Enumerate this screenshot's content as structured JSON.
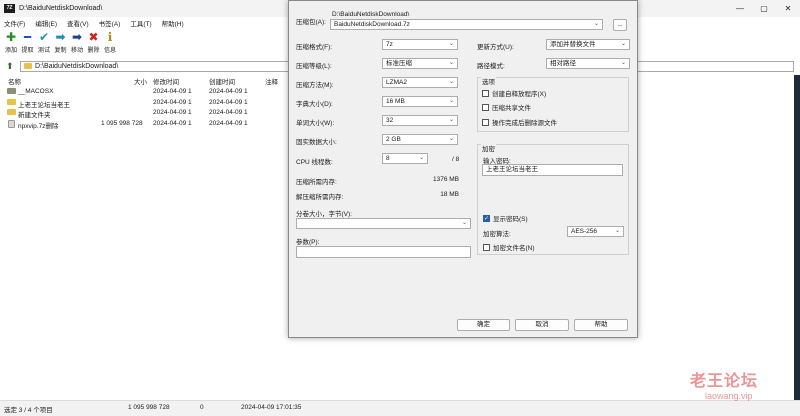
{
  "window": {
    "app_icon": "7Z",
    "title": "D:\\BaiduNetdiskDownload\\",
    "controls": {
      "minimize": "—",
      "maximize": "▢",
      "close": "✕"
    }
  },
  "menu": [
    "文件(F)",
    "编辑(E)",
    "查看(V)",
    "书签(A)",
    "工具(T)",
    "帮助(H)"
  ],
  "toolbar": [
    {
      "label": "添加",
      "icon": "plus-icon",
      "glyph": "✚",
      "color": "#1f8f1f"
    },
    {
      "label": "提取",
      "icon": "minus-icon",
      "glyph": "━",
      "color": "#1f4fb0"
    },
    {
      "label": "测试",
      "icon": "check-icon",
      "glyph": "✔",
      "color": "#1a9bb0"
    },
    {
      "label": "复制",
      "icon": "copy-arrow-icon",
      "glyph": "➡",
      "color": "#1a8fb0"
    },
    {
      "label": "移动",
      "icon": "move-arrow-icon",
      "glyph": "➡",
      "color": "#1f3f90"
    },
    {
      "label": "删除",
      "icon": "delete-icon",
      "glyph": "✖",
      "color": "#d02020"
    },
    {
      "label": "信息",
      "icon": "info-icon",
      "glyph": "ℹ",
      "color": "#b08a1a"
    }
  ],
  "address": {
    "path": "D:\\BaiduNetdiskDownload\\"
  },
  "file_list": {
    "columns": [
      "名称",
      "大小",
      "修改时间",
      "创建时间",
      "注释"
    ],
    "rows": [
      {
        "name": "__MACOSX",
        "size": "",
        "modified": "2024-04-09 1",
        "created": "2024-04-09 1",
        "type": "folder-dark"
      },
      {
        "name": "上老王论坛当老王",
        "size": "",
        "modified": "2024-04-09 1",
        "created": "2024-04-09 1",
        "type": "folder"
      },
      {
        "name": "新建文件夹",
        "size": "",
        "modified": "2024-04-09 1",
        "created": "2024-04-09 1",
        "type": "folder"
      },
      {
        "name": "npxvip.7z删除",
        "size": "1 095 998 728",
        "modified": "2024-04-09 1",
        "created": "2024-04-09 1",
        "type": "file"
      }
    ]
  },
  "status": {
    "selection": "选定 3 / 4 个项目",
    "size": "1 095 998 728",
    "count": "0",
    "datetime": "2024-04-09 17:01:35"
  },
  "dialog": {
    "archive_label": "压缩包(A):",
    "archive_dir": "D:\\BaiduNetdiskDownload\\",
    "archive_name": "BaiduNetdiskDownload.7z",
    "browse_label": "...",
    "format_label": "压缩格式(F):",
    "format_value": "7z",
    "level_label": "压缩等级(L):",
    "level_value": "标准压缩",
    "method_label": "压缩方法(M):",
    "method_value": "LZMA2",
    "dict_label": "字典大小(D):",
    "dict_value": "16 MB",
    "word_label": "单词大小(W):",
    "word_value": "32",
    "solid_label": "固实数据大小:",
    "solid_value": "2 GB",
    "threads_label": "CPU 线程数:",
    "threads_value": "8",
    "threads_max": "/ 8",
    "mem_comp_label": "压缩所需内存:",
    "mem_comp_value": "1376 MB",
    "mem_decomp_label": "解压缩所需内存:",
    "mem_decomp_value": "18 MB",
    "split_label": "分卷大小，字节(V):",
    "split_value": "",
    "params_label": "参数(P):",
    "params_value": "",
    "update_label": "更新方式(U):",
    "update_value": "添加并替换文件",
    "pathmode_label": "路径模式:",
    "pathmode_value": "相对路径",
    "options_title": "选项",
    "opt_sfx": "创建自释放程序(X)",
    "opt_shared": "压缩共享文件",
    "opt_delete": "操作完成后删除源文件",
    "encryption_title": "加密",
    "password_label": "输入密码:",
    "password_value": "上老王论坛当老王",
    "show_password": "显示密码(S)",
    "enc_method_label": "加密算法:",
    "enc_method_value": "AES-256",
    "encrypt_names": "加密文件名(N)",
    "ok": "确定",
    "cancel": "取消",
    "help": "帮助"
  },
  "watermark": {
    "cn": "老王论坛",
    "en": "laowang.vip"
  }
}
